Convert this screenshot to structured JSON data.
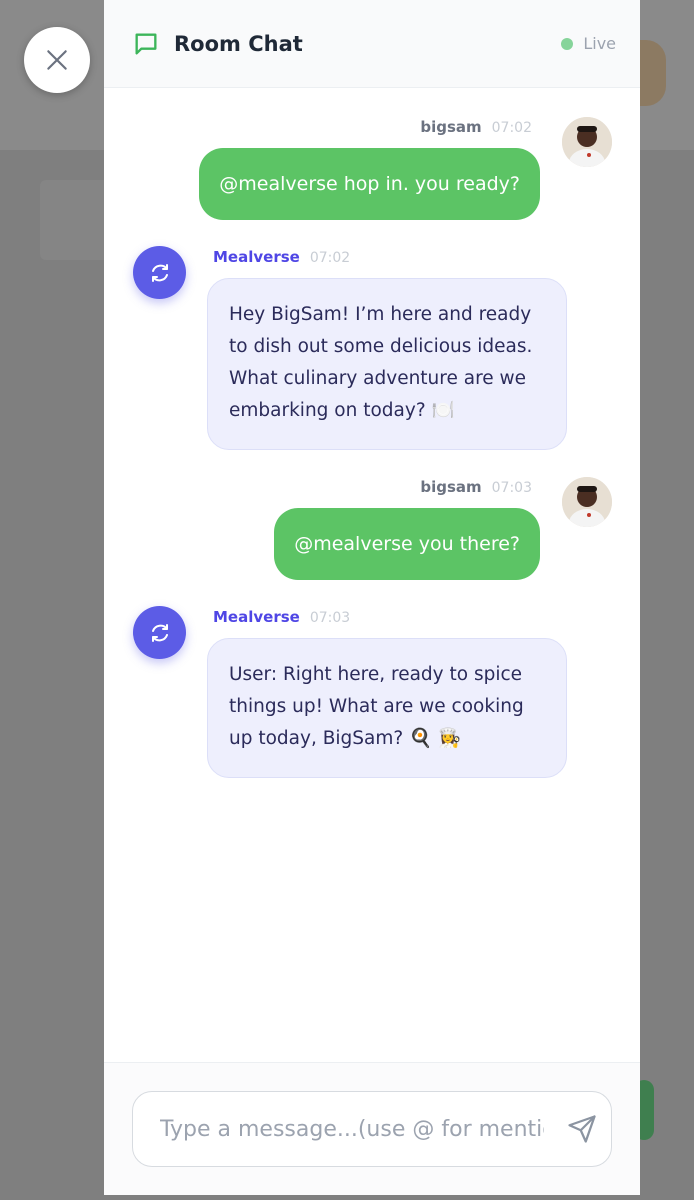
{
  "header": {
    "title": "Room Chat",
    "status": "Live",
    "icon": "chat-bubble-icon",
    "status_color": "#86d49a"
  },
  "messages": [
    {
      "sender": "bigsam",
      "time": "07:02",
      "text": "@mealverse hop in. you ready?",
      "type": "user"
    },
    {
      "sender": "Mealverse",
      "time": "07:02",
      "text": "Hey BigSam! I’m here and ready to dish out some delicious ideas. What culinary adventure are we embarking on today? 🍽️",
      "type": "bot"
    },
    {
      "sender": "bigsam",
      "time": "07:03",
      "text": "@mealverse you there?",
      "type": "user"
    },
    {
      "sender": "Mealverse",
      "time": "07:03",
      "text": "User: Right here, ready to spice things up! What are we cooking up today, BigSam? 🍳 👩‍🍳",
      "type": "bot"
    }
  ],
  "composer": {
    "placeholder": "Type a message...(use @ for mentions)",
    "value": ""
  },
  "colors": {
    "user_bubble": "#5cc465",
    "bot_bubble": "#eeeffd",
    "bot_accent": "#5c5ce6",
    "bot_name": "#4f46e5"
  },
  "icons": {
    "close": "close-icon",
    "bot": "refresh-icon",
    "send": "send-icon"
  }
}
